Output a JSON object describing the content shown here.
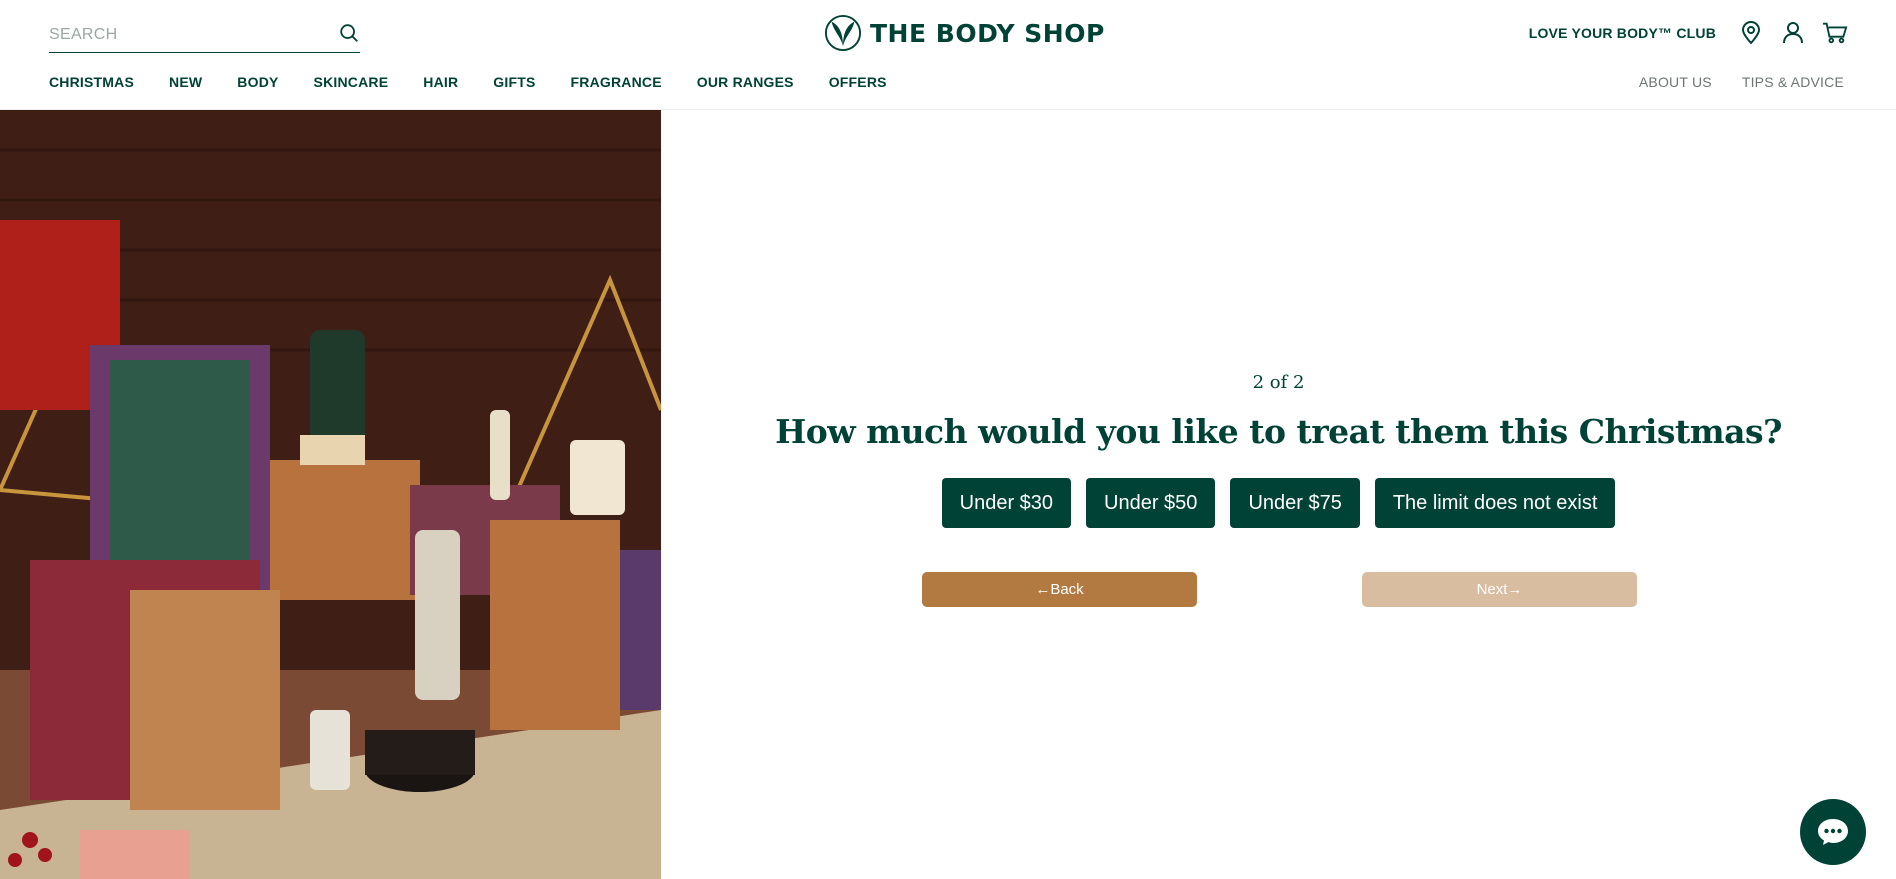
{
  "header": {
    "search": {
      "placeholder": "SEARCH"
    },
    "logo_text": "THE BODY SHOP",
    "club_link": "LOVE YOUR BODY™ CLUB",
    "nav": [
      "CHRISTMAS",
      "NEW",
      "BODY",
      "SKINCARE",
      "HAIR",
      "GIFTS",
      "FRAGRANCE",
      "OUR RANGES",
      "OFFERS"
    ],
    "nav_right": [
      "ABOUT US",
      "TIPS & ADVICE"
    ],
    "icons": [
      "search-icon",
      "location-pin-icon",
      "account-icon",
      "cart-icon"
    ]
  },
  "quiz": {
    "step": "2 of 2",
    "question": "How much would you like to treat them this Christmas?",
    "options": [
      "Under $30",
      "Under $50",
      "Under $75",
      "The limit does not exist"
    ],
    "back_label": "←Back",
    "next_label": "Next→"
  },
  "chat": {
    "icon": "chat-bubble-icon"
  },
  "colors": {
    "brand_green": "#004236",
    "back_button": "#b27a40",
    "next_button_disabled": "#d9bda1"
  }
}
